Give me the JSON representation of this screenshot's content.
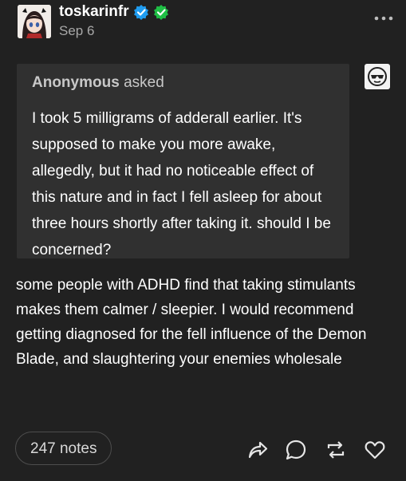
{
  "post": {
    "author": "toskarinfr",
    "date": "Sep 6",
    "badges": [
      "verified-blue-check-icon",
      "verified-green-check-icon"
    ],
    "accent_blue": "#1f9cf0",
    "accent_green": "#1fbf45"
  },
  "ask": {
    "asker": "Anonymous",
    "verb": "asked",
    "question": "I took 5 milligrams of adderall earlier. It's supposed to make you more awake, allegedly, but it had no noticeable effect of this nature and in fact I fell asleep for about three hours shortly after taking it. should I be concerned?"
  },
  "answer": {
    "text": "some people with ADHD find that taking stimulants makes them calmer / sleepier. I would recommend getting diagnosed for the fell influence of the Demon Blade, and slaughtering your enemies wholesale"
  },
  "footer": {
    "notes_label": "247 notes",
    "actions": [
      "share-icon",
      "reply-icon",
      "reblog-icon",
      "like-icon"
    ]
  }
}
